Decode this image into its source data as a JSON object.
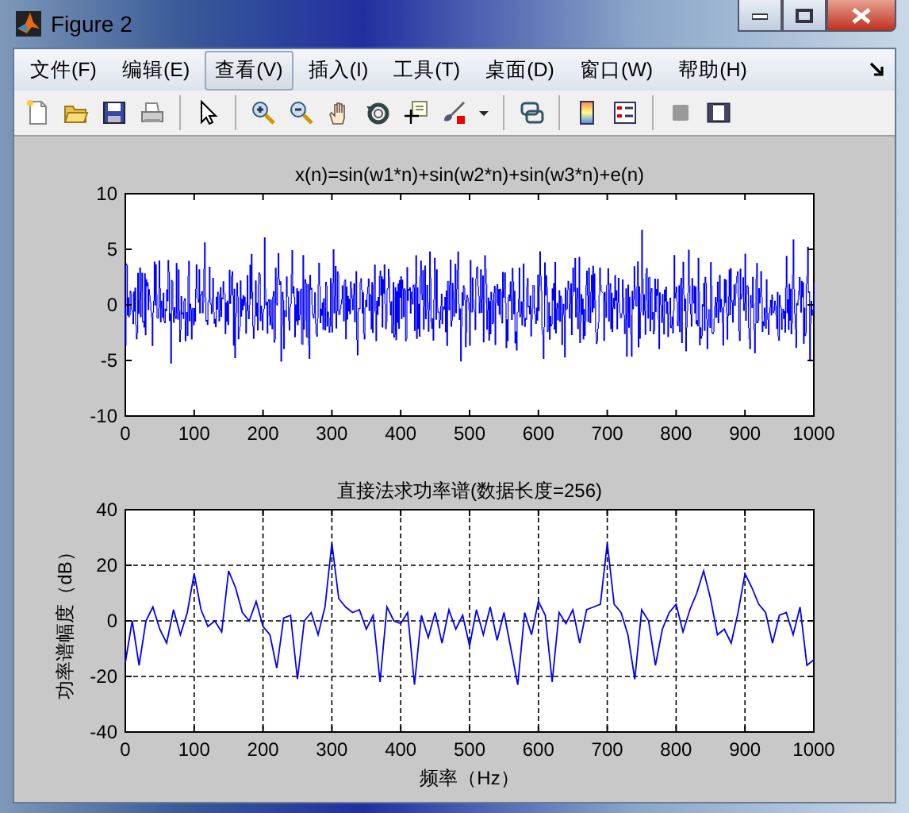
{
  "window": {
    "title": "Figure 2"
  },
  "menu": [
    {
      "label": "文件(F)",
      "selected": false
    },
    {
      "label": "编辑(E)",
      "selected": false
    },
    {
      "label": "查看(V)",
      "selected": true
    },
    {
      "label": "插入(I)",
      "selected": false
    },
    {
      "label": "工具(T)",
      "selected": false
    },
    {
      "label": "桌面(D)",
      "selected": false
    },
    {
      "label": "窗口(W)",
      "selected": false
    },
    {
      "label": "帮助(H)",
      "selected": false
    }
  ],
  "signal_plot": {
    "title": "x(n)=sin(w1*n)+sin(w2*n)+sin(w3*n)+e(n)",
    "xticks": [
      "0",
      "100",
      "200",
      "300",
      "400",
      "500",
      "600",
      "700",
      "800",
      "900",
      "1000"
    ],
    "yticks": [
      "10",
      "5",
      "0",
      "-5",
      "-10"
    ]
  },
  "spectrum_plot": {
    "chart_data": {
      "type": "line",
      "title": "直接法求功率谱(数据长度=256)",
      "xlabel": "频率（Hz）",
      "ylabel": "功率谱幅度（dB）",
      "xlim": [
        0,
        1000
      ],
      "ylim": [
        -40,
        40
      ],
      "xticks": [
        0,
        100,
        200,
        300,
        400,
        500,
        600,
        700,
        800,
        900,
        1000
      ],
      "yticks": [
        -40,
        -20,
        0,
        20,
        40
      ],
      "grid": true,
      "x": [
        0,
        10,
        20,
        30,
        40,
        50,
        60,
        70,
        80,
        90,
        100,
        110,
        120,
        130,
        140,
        150,
        160,
        170,
        180,
        190,
        200,
        210,
        220,
        230,
        240,
        250,
        260,
        270,
        280,
        290,
        300,
        310,
        320,
        330,
        340,
        350,
        360,
        370,
        380,
        390,
        400,
        410,
        420,
        430,
        440,
        450,
        460,
        470,
        480,
        490,
        500,
        510,
        520,
        530,
        540,
        550,
        560,
        570,
        580,
        590,
        600,
        610,
        620,
        630,
        640,
        650,
        660,
        670,
        680,
        690,
        700,
        710,
        720,
        730,
        740,
        750,
        760,
        770,
        780,
        790,
        800,
        810,
        820,
        830,
        840,
        850,
        860,
        870,
        880,
        890,
        900,
        910,
        920,
        930,
        940,
        950,
        960,
        970,
        980,
        990,
        1000
      ],
      "series": [
        {
          "color": "#0000ff",
          "values": [
            -15,
            0,
            -16,
            0,
            5,
            -3,
            -8,
            4,
            -5,
            3,
            17,
            4,
            -2,
            0,
            -4,
            18,
            12,
            3,
            0,
            7,
            -2,
            -5,
            -17,
            1,
            2,
            -21,
            0,
            3,
            -5,
            5,
            28,
            8,
            5,
            3,
            4,
            -3,
            2,
            -22,
            5,
            0,
            -1,
            3,
            -23,
            2,
            -6,
            3,
            -8,
            4,
            -3,
            2,
            -9,
            4,
            -5,
            5,
            -7,
            3,
            -10,
            -23,
            3,
            -5,
            7,
            2,
            -22,
            3,
            -1,
            4,
            -8,
            4,
            5,
            6,
            28,
            6,
            3,
            -5,
            -21,
            4,
            0,
            -16,
            -3,
            3,
            6,
            -4,
            4,
            10,
            18,
            8,
            -5,
            -3,
            -8,
            3,
            17,
            12,
            6,
            3,
            -8,
            2,
            3,
            -5,
            5,
            -16,
            -14
          ]
        }
      ]
    }
  }
}
